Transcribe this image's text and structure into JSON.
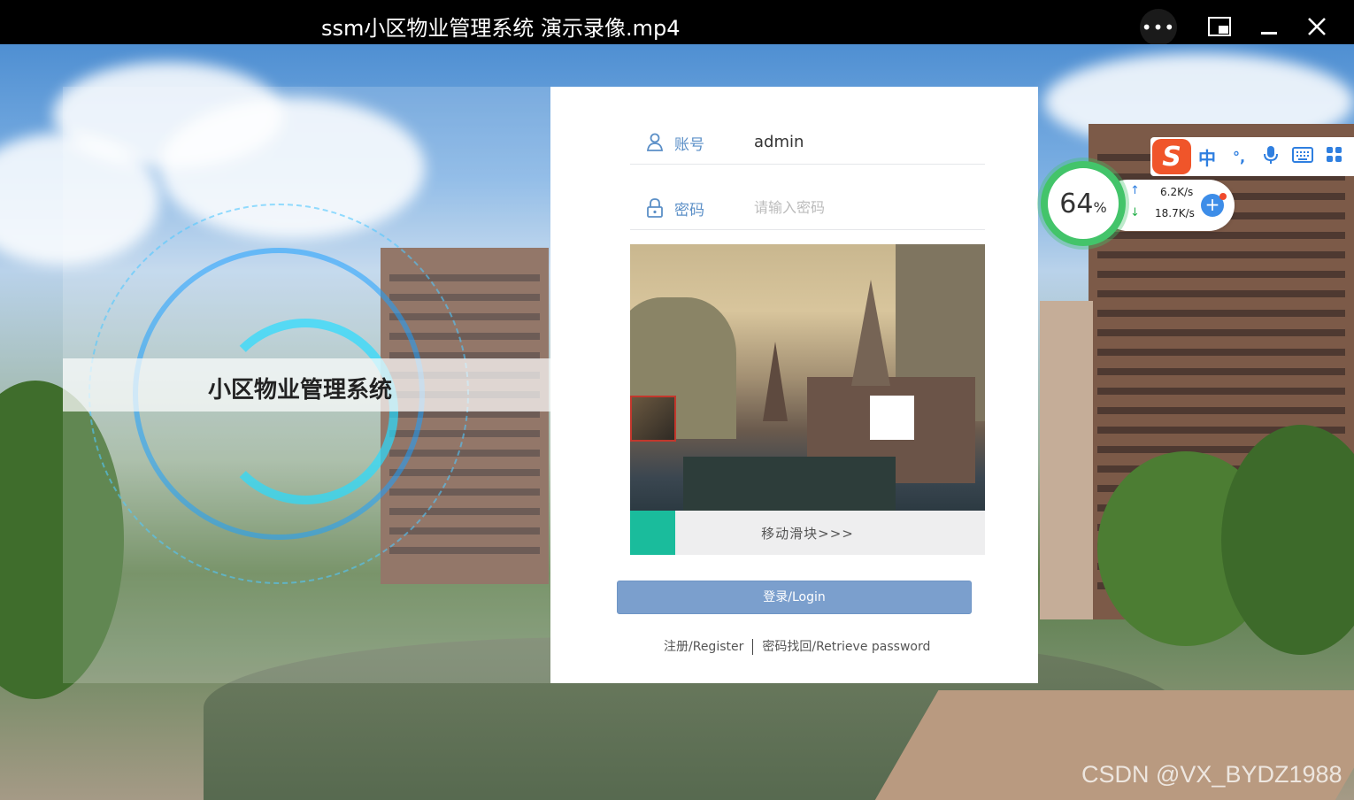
{
  "window": {
    "title": "ssm小区物业管理系统 演示录像.mp4",
    "more_label": "•••",
    "pip_label": "⧉",
    "minimize_label": "—",
    "close_label": "✕"
  },
  "brand": {
    "title": "小区物业管理系统"
  },
  "login": {
    "username_label": "账号",
    "username_value": "admin",
    "password_label": "密码",
    "password_placeholder": "请输入密码",
    "slider_text": "移动滑块>>>",
    "login_button": "登录/Login",
    "register_link": "注册/Register",
    "retrieve_link": "密码找回/Retrieve password"
  },
  "ime": {
    "logo": "S",
    "mode": "中",
    "punct": "°,",
    "voice_icon": "microphone-icon",
    "keyboard_icon": "keyboard-icon",
    "apps_icon": "grid-icon"
  },
  "net_monitor": {
    "percent": "64",
    "percent_unit": "%",
    "upload": "6.2K/s",
    "download": "18.7K/s"
  },
  "watermark": "CSDN @VX_BYDZ1988",
  "colors": {
    "accent_blue": "#5b8fc7",
    "login_button": "#7b9fcd",
    "slider_handle": "#1abc9c",
    "gauge_green": "#43c46a"
  }
}
